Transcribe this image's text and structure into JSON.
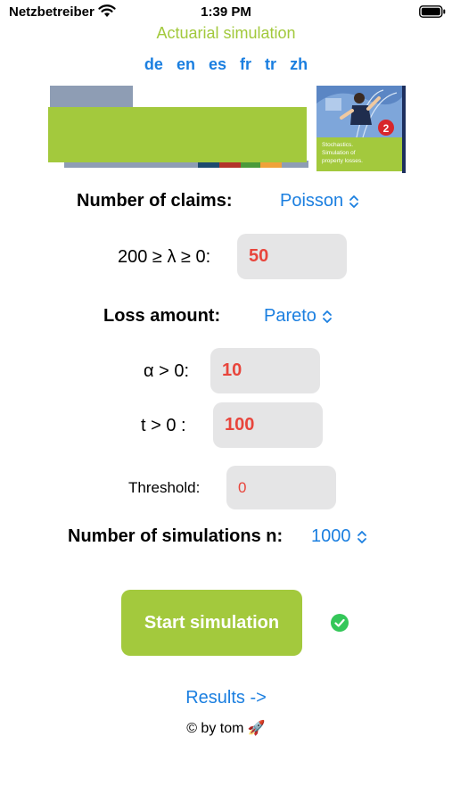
{
  "status_bar": {
    "carrier": "Netzbetreiber",
    "time": "1:39 PM"
  },
  "app_title": "Actuarial simulation",
  "languages": [
    "de",
    "en",
    "es",
    "fr",
    "tr",
    "zh"
  ],
  "book_cover": {
    "badge": "2",
    "text_line1": "Stochastics.",
    "text_line2": "Simulation of",
    "text_line3": "property losses."
  },
  "claims": {
    "label": "Number of claims:",
    "distribution": "Poisson"
  },
  "lambda": {
    "label": "200 ≥ λ ≥ 0:",
    "value": "50"
  },
  "loss": {
    "label": "Loss amount:",
    "distribution": "Pareto"
  },
  "alpha": {
    "label": "α > 0:",
    "value": "10"
  },
  "t_param": {
    "label": "t > 0 :",
    "value": "100"
  },
  "threshold": {
    "label": "Threshold:",
    "value": "0"
  },
  "simulations": {
    "label": "Number of simulations n:",
    "value": "1000"
  },
  "start_button": "Start simulation",
  "results_link": "Results ->",
  "footer": "© by tom 🚀",
  "colors": {
    "accent_green": "#a3c93d",
    "link_blue": "#1b7fe0",
    "value_red": "#e8453c",
    "success_green": "#34c759"
  }
}
